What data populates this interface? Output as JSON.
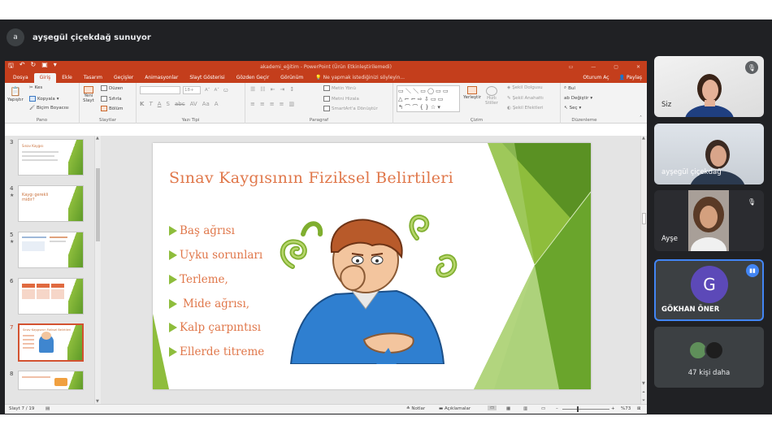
{
  "meet": {
    "presenter_initial": "a",
    "presenting_label": "ayşegül çiçekdağ sunuyor",
    "participants": [
      {
        "name": "Siz",
        "muted": true
      },
      {
        "name": "ayşegül çiçekdağ",
        "muted": false
      },
      {
        "name": "Ayşe",
        "muted": true
      },
      {
        "name": "GÖKHAN ÖNER",
        "initial": "G",
        "speaking": true,
        "avatar_color": "#5c49b8"
      }
    ],
    "more_label": "47 kişi daha"
  },
  "ppt": {
    "title": "akademi_eğitim - PowerPoint (Ürün Etkinleştirilemedi)",
    "tabs": [
      "Dosya",
      "Giriş",
      "Ekle",
      "Tasarım",
      "Geçişler",
      "Animasyonlar",
      "Slayt Gösterisi",
      "Gözden Geçir",
      "Görünüm"
    ],
    "active_tab": "Giriş",
    "tell_me": "Ne yapmak istediğinizi söyleyin...",
    "signin": "Oturum Aç",
    "share": "Paylaş",
    "ribbon": {
      "clipboard": {
        "label": "Pano",
        "paste": "Yapıştır",
        "cut": "Kes",
        "copy": "Kopyala",
        "format_painter": "Biçim Boyacısı"
      },
      "slides": {
        "label": "Slaytlar",
        "new_slide_1": "Yeni",
        "new_slide_2": "Slayt",
        "layout": "Düzen",
        "reset": "Sıfırla",
        "section": "Bölüm"
      },
      "font": {
        "label": "Yazı Tipi",
        "size": "18+"
      },
      "paragraph": {
        "label": "Paragraf",
        "text_direction": "Metin Yönü",
        "align_text": "Metni Hizala",
        "smartart": "SmartArt'a Dönüştür"
      },
      "drawing": {
        "label": "Çizim",
        "arrange": "Yerleştir",
        "quick_styles_1": "Hızlı",
        "quick_styles_2": "Stiller",
        "fill": "Şekil Dolgusu",
        "outline": "Şekil Anahattı",
        "effects": "Şekil Efektleri"
      },
      "editing": {
        "label": "Düzenleme",
        "find": "Bul",
        "replace": "Değiştir",
        "select": "Seç"
      }
    },
    "thumbnails": [
      {
        "num": "3",
        "star": false,
        "title": "Sınav Kaygısı"
      },
      {
        "num": "4",
        "star": true,
        "title": "Kaygı gerekli midir?"
      },
      {
        "num": "5",
        "star": true,
        "title": ""
      },
      {
        "num": "6",
        "star": false,
        "title": ""
      },
      {
        "num": "7",
        "star": false,
        "title": "Sınav Kaygısının Fiziksel Belirtileri",
        "selected": true
      },
      {
        "num": "8",
        "star": false,
        "title": ""
      }
    ],
    "slide": {
      "title": "Sınav Kaygısının Fiziksel Belirtileri",
      "bullets": [
        "Baş ağrısı",
        "Uyku sorunları",
        "Terleme,",
        "Mide ağrısı,",
        "Kalp çarpıntısı",
        "Ellerde titreme"
      ]
    },
    "status": {
      "slide_indicator": "Slayt 7 / 19",
      "notes": "Notlar",
      "comments": "Açıklamalar",
      "zoom": "%73"
    }
  },
  "colors": {
    "ppt_red": "#c43e1c",
    "accent_green": "#8ebd3c",
    "slide_text": "#e0774a",
    "meet_bg": "#202124",
    "speaking_blue": "#4285f4"
  }
}
